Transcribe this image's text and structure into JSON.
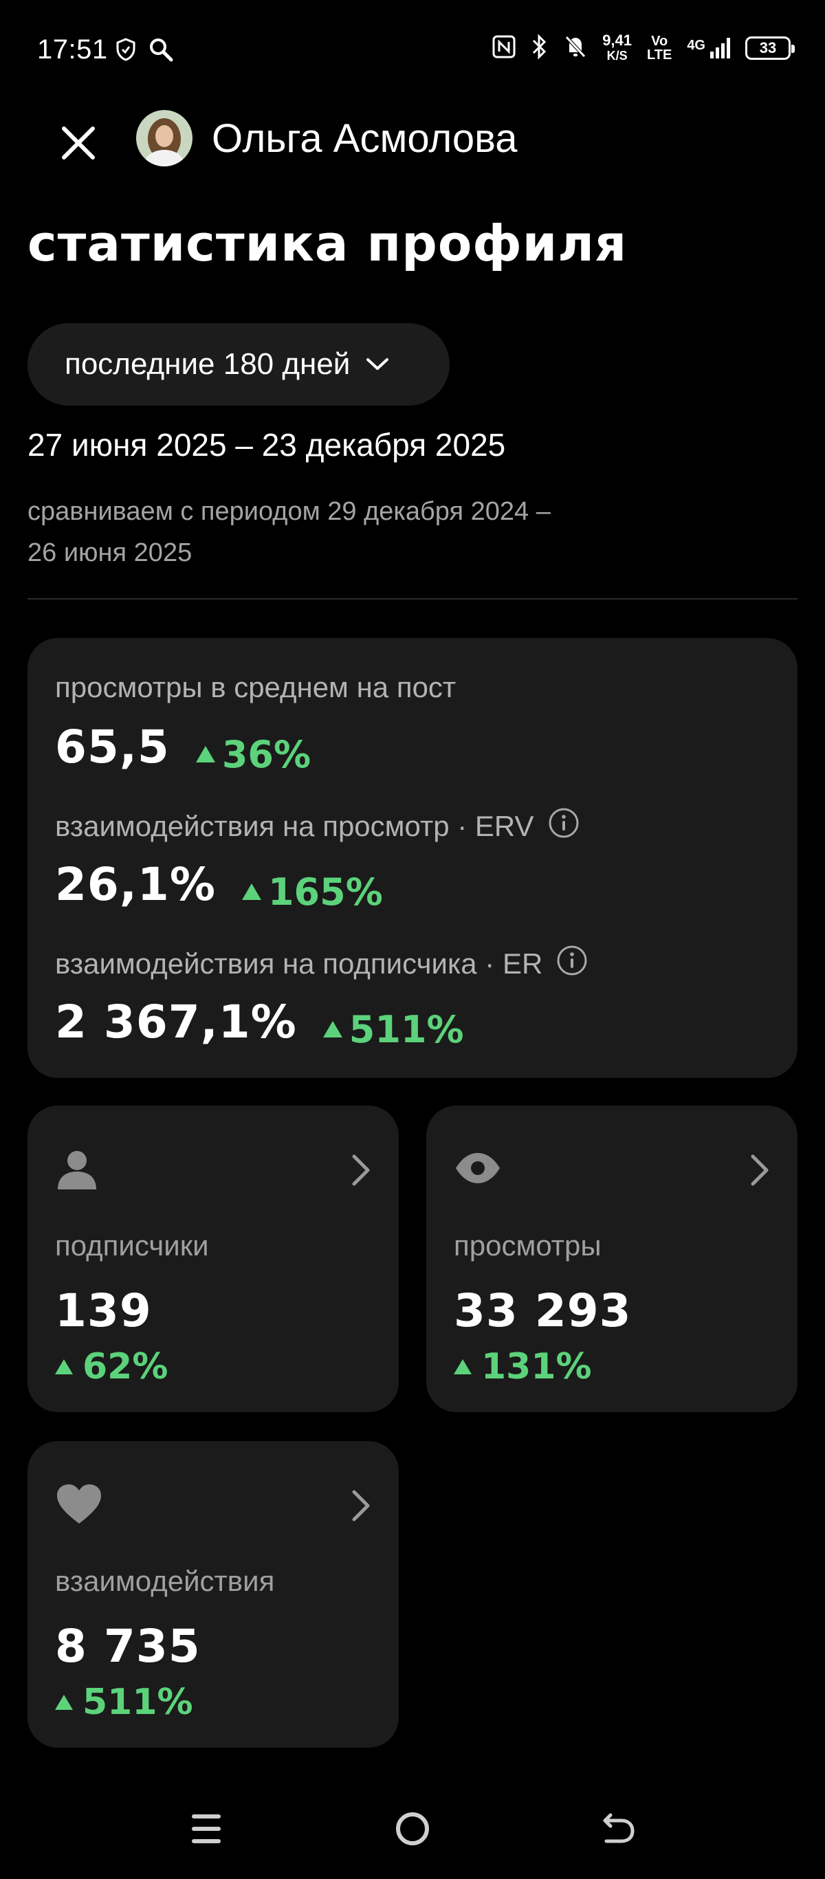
{
  "status_bar": {
    "time": "17:51",
    "speed_value": "9,41",
    "speed_unit": "K/S",
    "volte_top": "Vo",
    "volte_bottom": "LTE",
    "network": "4G",
    "battery": "33"
  },
  "header": {
    "profile_name": "Ольга Асмолова",
    "title": "статистика профиля"
  },
  "period": {
    "selected": "последние 180 дней",
    "range": "27 июня 2025 – 23 декабря 2025",
    "compare_line1": "сравниваем с периодом 29 декабря 2024 –",
    "compare_line2": "26 июня 2025"
  },
  "summary": {
    "views_per_post_label": "просмотры в среднем на пост",
    "views_per_post_value": "65,5",
    "views_per_post_delta": "36%",
    "erv_label": "взаимодействия на просмотр · ERV",
    "erv_value": "26,1%",
    "erv_delta": "165%",
    "er_label": "взаимодействия на подписчика · ER",
    "er_value": "2 367,1%",
    "er_delta": "511%"
  },
  "cards": {
    "subscribers": {
      "label": "подписчики",
      "value": "139",
      "delta": "62%"
    },
    "views": {
      "label": "просмотры",
      "value": "33 293",
      "delta": "131%"
    },
    "interactions": {
      "label": "взаимодействия",
      "value": "8 735",
      "delta": "511%"
    }
  },
  "colors": {
    "background": "#000000",
    "card": "#1b1b1b",
    "positive": "#5cd27b",
    "muted_text": "#a0a0a0"
  }
}
